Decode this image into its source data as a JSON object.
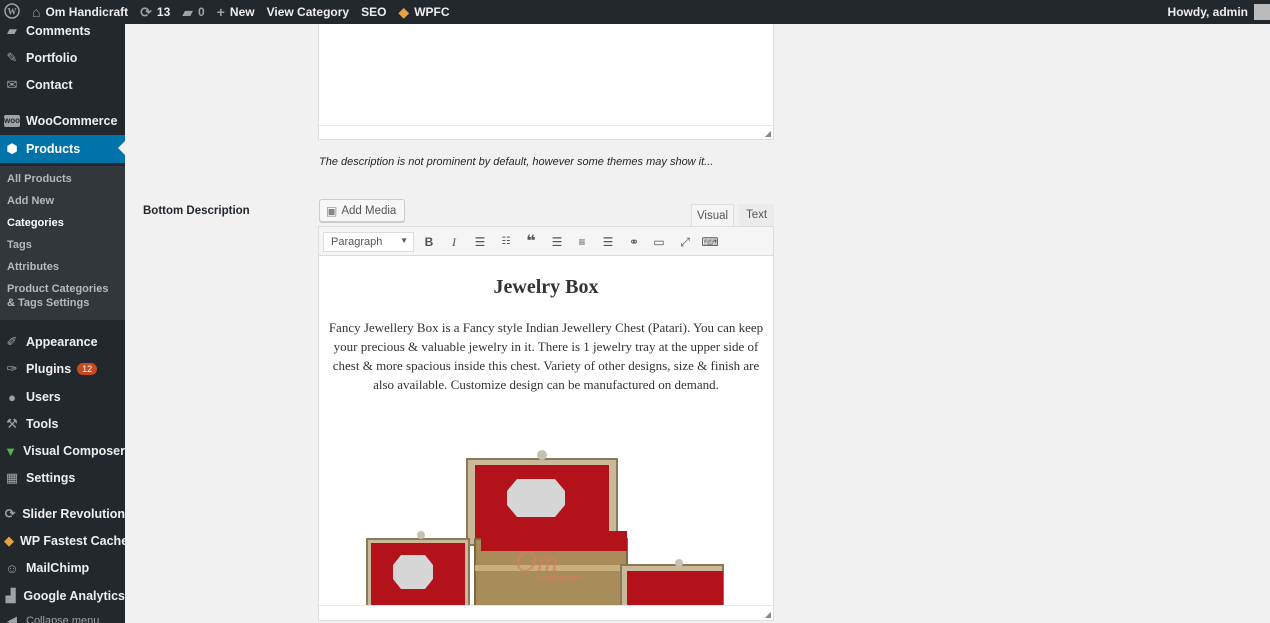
{
  "admin_bar": {
    "site_name": "Om Handicraft",
    "updates_count": "13",
    "comments_count": "0",
    "new_label": "New",
    "view_category": "View Category",
    "seo": "SEO",
    "wpfc": "WPFC",
    "greeting": "Howdy, admin"
  },
  "sidebar": {
    "items": [
      {
        "label": "Comments",
        "icon": "comment-icon"
      },
      {
        "label": "Portfolio",
        "icon": "pin-icon"
      },
      {
        "label": "Contact",
        "icon": "envelope-icon"
      },
      {
        "label": "WooCommerce",
        "icon": "woo-icon"
      },
      {
        "label": "Products",
        "icon": "box-icon"
      },
      {
        "label": "Appearance",
        "icon": "paintbrush-icon"
      },
      {
        "label": "Plugins",
        "icon": "plug-icon",
        "badge": "12"
      },
      {
        "label": "Users",
        "icon": "user-icon"
      },
      {
        "label": "Tools",
        "icon": "wrench-icon"
      },
      {
        "label": "Visual Composer",
        "icon": "vc-icon"
      },
      {
        "label": "Settings",
        "icon": "settings-icon"
      },
      {
        "label": "Slider Revolution",
        "icon": "refresh-icon"
      },
      {
        "label": "WP Fastest Cache",
        "icon": "cheetah-icon"
      },
      {
        "label": "MailChimp",
        "icon": "chimp-icon"
      },
      {
        "label": "Google Analytics",
        "icon": "analytics-icon"
      },
      {
        "label": "Collapse menu",
        "icon": "collapse-icon"
      }
    ],
    "submenu": [
      {
        "label": "All Products"
      },
      {
        "label": "Add New"
      },
      {
        "label": "Categories"
      },
      {
        "label": "Tags"
      },
      {
        "label": "Attributes"
      },
      {
        "label": "Product Categories & Tags Settings"
      }
    ]
  },
  "form": {
    "hint": "The description is not prominent by default, however some themes may show it...",
    "bottom_description_label": "Bottom Description",
    "add_media": "Add Media",
    "tab_visual": "Visual",
    "tab_text": "Text",
    "format_select": "Paragraph"
  },
  "editor_content": {
    "heading": "Jewelry Box",
    "body": "Fancy Jewellery Box is a Fancy style Indian Jewellery Chest (Patari). You can keep your precious & valuable jewelry in it. There is 1 jewelry tray at the upper side of chest & more spacious inside this chest. Variety of other designs, size & finish are also available. Customize design can be manufactured on demand.",
    "image_watermark": "Om",
    "image_watermark_sub": "HANDICRAFT"
  },
  "colors": {
    "admin_dark": "#23282d",
    "active_blue": "#0073aa",
    "badge_orange": "#ca4a1f",
    "velvet_red": "#b3121b"
  }
}
